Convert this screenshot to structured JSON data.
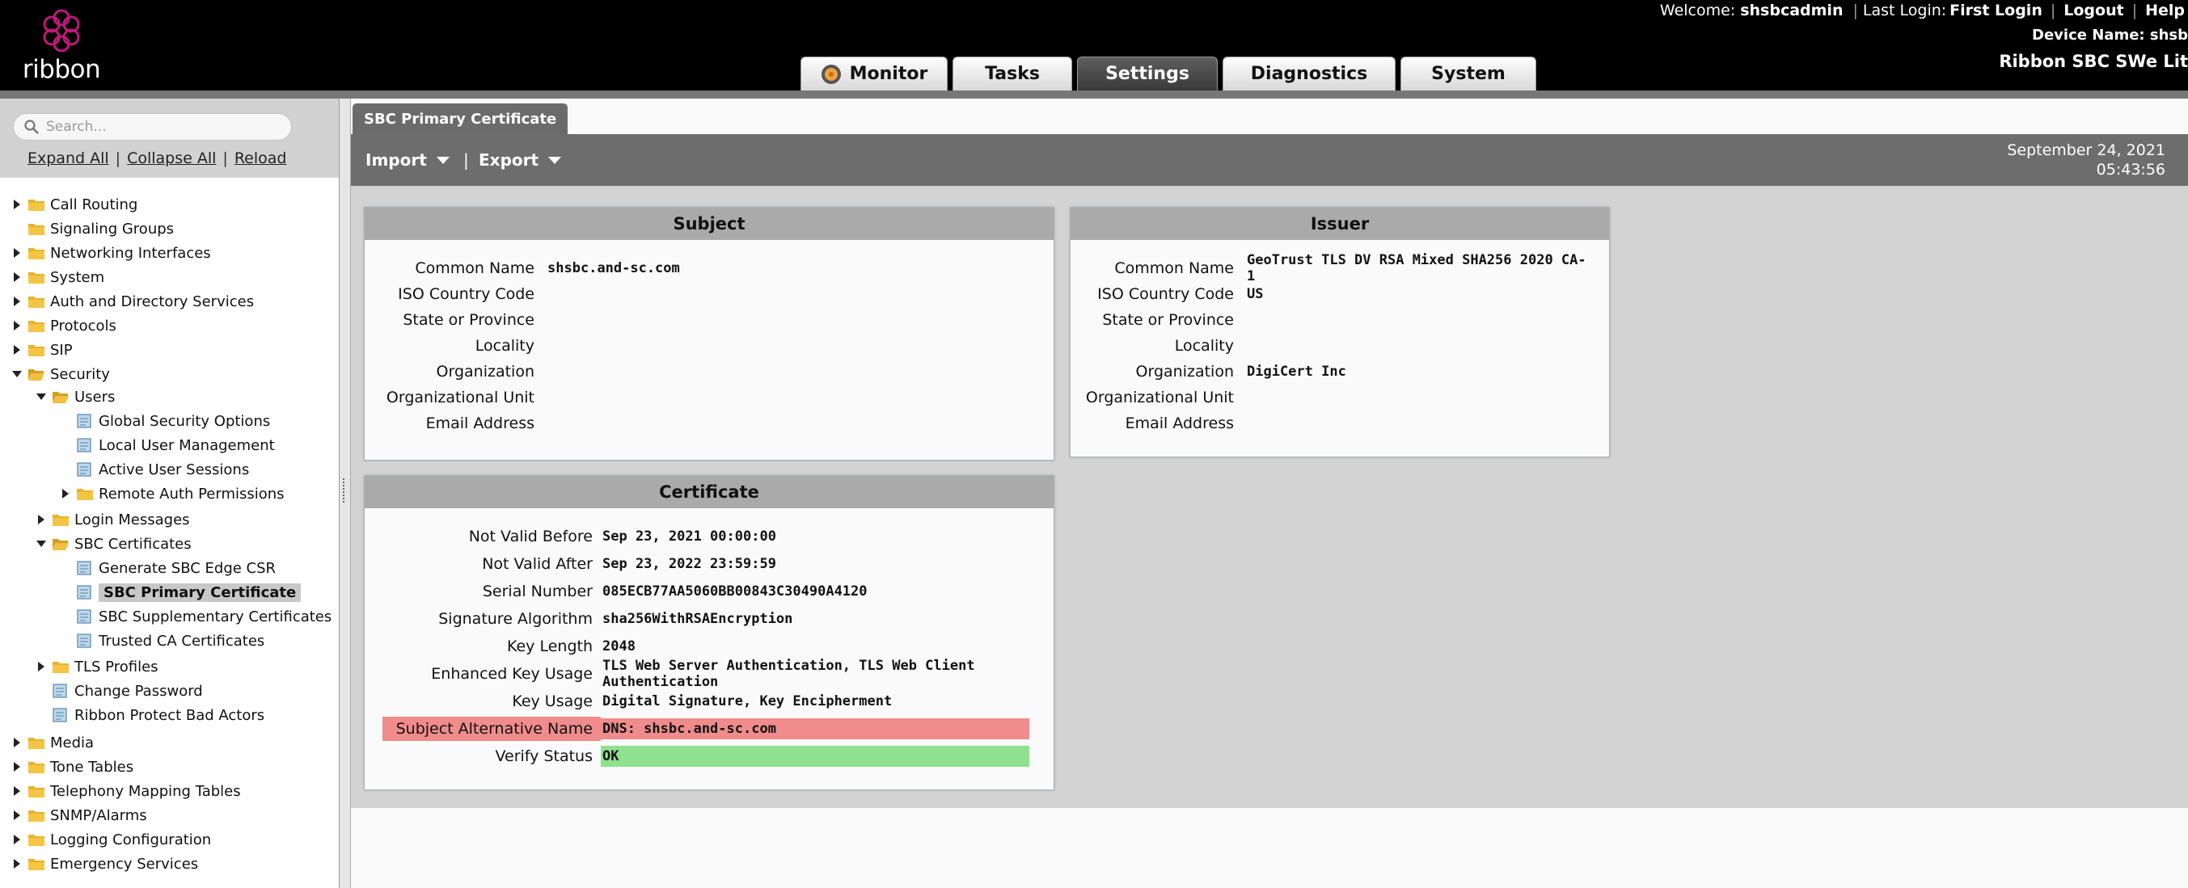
{
  "header": {
    "logo_text": "ribbon",
    "welcome_label": "Welcome:",
    "username": "shsbcadmin",
    "last_login_label": "Last Login:",
    "first_login": "First Login",
    "logout": "Logout",
    "help": "Help",
    "device_name": "Device Name: shsb",
    "product": "Ribbon SBC SWe Lit",
    "tabs": [
      "Monitor",
      "Tasks",
      "Settings",
      "Diagnostics",
      "System"
    ],
    "active_tab": "Settings"
  },
  "sidebar": {
    "search_placeholder": "Search...",
    "expand_all": "Expand All",
    "collapse_all": "Collapse All",
    "reload": "Reload",
    "tree": [
      {
        "label": "Call Routing",
        "level": 0,
        "type": "folder",
        "state": "collapsed"
      },
      {
        "label": "Signaling Groups",
        "level": 0,
        "type": "folder",
        "state": "leaf"
      },
      {
        "label": "Networking Interfaces",
        "level": 0,
        "type": "folder",
        "state": "collapsed"
      },
      {
        "label": "System",
        "level": 0,
        "type": "folder",
        "state": "collapsed"
      },
      {
        "label": "Auth and Directory Services",
        "level": 0,
        "type": "folder",
        "state": "collapsed"
      },
      {
        "label": "Protocols",
        "level": 0,
        "type": "folder",
        "state": "collapsed"
      },
      {
        "label": "SIP",
        "level": 0,
        "type": "folder",
        "state": "collapsed"
      },
      {
        "label": "Security",
        "level": 0,
        "type": "folder",
        "state": "expanded"
      },
      {
        "label": "Users",
        "level": 1,
        "type": "folder",
        "state": "expanded"
      },
      {
        "label": "Global Security Options",
        "level": 2,
        "type": "page"
      },
      {
        "label": "Local User Management",
        "level": 2,
        "type": "page"
      },
      {
        "label": "Active User Sessions",
        "level": 2,
        "type": "page"
      },
      {
        "label": "Remote Auth Permissions",
        "level": 2,
        "type": "folder",
        "state": "collapsed"
      },
      {
        "label": "Login Messages",
        "level": 1,
        "type": "folder",
        "state": "collapsed"
      },
      {
        "label": "SBC Certificates",
        "level": 1,
        "type": "folder",
        "state": "expanded"
      },
      {
        "label": "Generate SBC Edge CSR",
        "level": 2,
        "type": "page"
      },
      {
        "label": "SBC Primary Certificate",
        "level": 2,
        "type": "page",
        "selected": true
      },
      {
        "label": "SBC Supplementary Certificates",
        "level": 2,
        "type": "page"
      },
      {
        "label": "Trusted CA Certificates",
        "level": 2,
        "type": "page"
      },
      {
        "label": "TLS Profiles",
        "level": 1,
        "type": "folder",
        "state": "collapsed"
      },
      {
        "label": "Change Password",
        "level": 1,
        "type": "page"
      },
      {
        "label": "Ribbon Protect Bad Actors",
        "level": 1,
        "type": "page"
      },
      {
        "label": "Media",
        "level": 0,
        "type": "folder",
        "state": "collapsed"
      },
      {
        "label": "Tone Tables",
        "level": 0,
        "type": "folder",
        "state": "collapsed"
      },
      {
        "label": "Telephony Mapping Tables",
        "level": 0,
        "type": "folder",
        "state": "collapsed"
      },
      {
        "label": "SNMP/Alarms",
        "level": 0,
        "type": "folder",
        "state": "collapsed"
      },
      {
        "label": "Logging Configuration",
        "level": 0,
        "type": "folder",
        "state": "collapsed"
      },
      {
        "label": "Emergency Services",
        "level": 0,
        "type": "folder",
        "state": "collapsed"
      }
    ]
  },
  "main": {
    "page_tab": "SBC Primary Certificate",
    "import_label": "Import",
    "export_label": "Export",
    "toolbar_sep": "|",
    "date": "September 24, 2021",
    "time": "05:43:56",
    "subject": {
      "title": "Subject",
      "rows": [
        {
          "key": "Common Name",
          "value": "shsbc.and-sc.com"
        },
        {
          "key": "ISO Country Code",
          "value": ""
        },
        {
          "key": "State or Province",
          "value": ""
        },
        {
          "key": "Locality",
          "value": ""
        },
        {
          "key": "Organization",
          "value": ""
        },
        {
          "key": "Organizational Unit",
          "value": ""
        },
        {
          "key": "Email Address",
          "value": ""
        }
      ]
    },
    "issuer": {
      "title": "Issuer",
      "rows": [
        {
          "key": "Common Name",
          "value": "GeoTrust TLS DV RSA Mixed SHA256 2020 CA-1"
        },
        {
          "key": "ISO Country Code",
          "value": "US"
        },
        {
          "key": "State or Province",
          "value": ""
        },
        {
          "key": "Locality",
          "value": ""
        },
        {
          "key": "Organization",
          "value": "DigiCert Inc"
        },
        {
          "key": "Organizational Unit",
          "value": ""
        },
        {
          "key": "Email Address",
          "value": ""
        }
      ]
    },
    "certificate": {
      "title": "Certificate",
      "rows": [
        {
          "key": "Not Valid Before",
          "value": "Sep 23, 2021 00:00:00"
        },
        {
          "key": "Not Valid After",
          "value": "Sep 23, 2022 23:59:59"
        },
        {
          "key": "Serial Number",
          "value": "085ECB77AA5060BB00843C30490A4120"
        },
        {
          "key": "Signature Algorithm",
          "value": "sha256WithRSAEncryption"
        },
        {
          "key": "Key Length",
          "value": "2048"
        },
        {
          "key": "Enhanced Key Usage",
          "value": "TLS Web Server Authentication, TLS Web Client Authentication"
        },
        {
          "key": "Key Usage",
          "value": "Digital Signature, Key Encipherment"
        },
        {
          "key": "Subject Alternative Name",
          "value": "DNS: shsbc.and-sc.com",
          "status": "error"
        },
        {
          "key": "Verify Status",
          "value": "OK",
          "status": "ok"
        }
      ]
    }
  },
  "colors": {
    "error_highlight": "#f08c8c",
    "ok_highlight": "#8fe08f",
    "brand": "#c0187a"
  }
}
